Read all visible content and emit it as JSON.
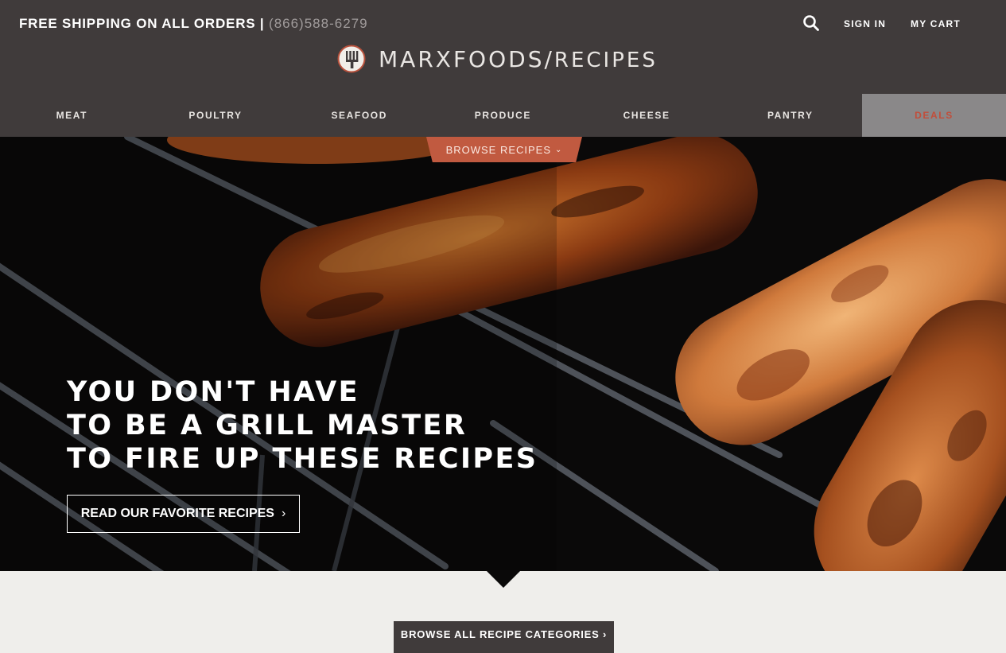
{
  "header": {
    "shipping_text": "FREE SHIPPING ON ALL ORDERS |",
    "phone": "(866)588-6279",
    "sign_in": "SIGN IN",
    "cart": "MY CART",
    "logo_text": "MARXFOODS/",
    "logo_sub": "RECIPES"
  },
  "nav": {
    "items": [
      "MEAT",
      "POULTRY",
      "SEAFOOD",
      "PRODUCE",
      "CHEESE",
      "PANTRY",
      "DEALS"
    ]
  },
  "hero": {
    "browse_label": "BROWSE RECIPES",
    "headline_lines": [
      "YOU DON'T HAVE",
      "TO BE A GRILL MASTER",
      "TO FIRE UP THESE RECIPES"
    ],
    "cta_label": "READ OUR FAVORITE RECIPES",
    "cta_arrow": "›"
  },
  "lower": {
    "all_categories_label": "BROWSE ALL RECIPE CATEGORIES ›"
  },
  "icons": {
    "search": "search-icon",
    "logo": "fork-logo-icon",
    "dropdown": "chevron-down-icon",
    "cta_arrow": "chevron-right-icon"
  },
  "colors": {
    "header_bg": "#403b3b",
    "accent": "#c15a40",
    "deals_bg": "#8a8889",
    "deals_text": "#c14e3b",
    "page_bg": "#efeeeb"
  }
}
